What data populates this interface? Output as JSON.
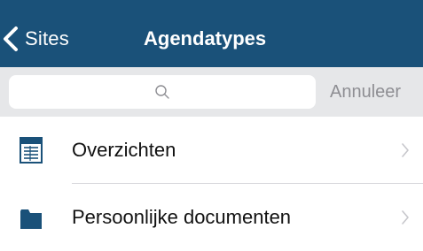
{
  "navbar": {
    "back_label": "Sites",
    "title": "Agendatypes",
    "background_color": "#1a5179"
  },
  "search": {
    "value": "",
    "icon": "search-icon",
    "cancel_label": "Annuleer"
  },
  "list": {
    "items": [
      {
        "label": "Overzichten",
        "icon": "document-list-icon"
      },
      {
        "label": "Persoonlijke documenten",
        "icon": "folder-icon"
      }
    ],
    "icon_color": "#1a5179"
  }
}
